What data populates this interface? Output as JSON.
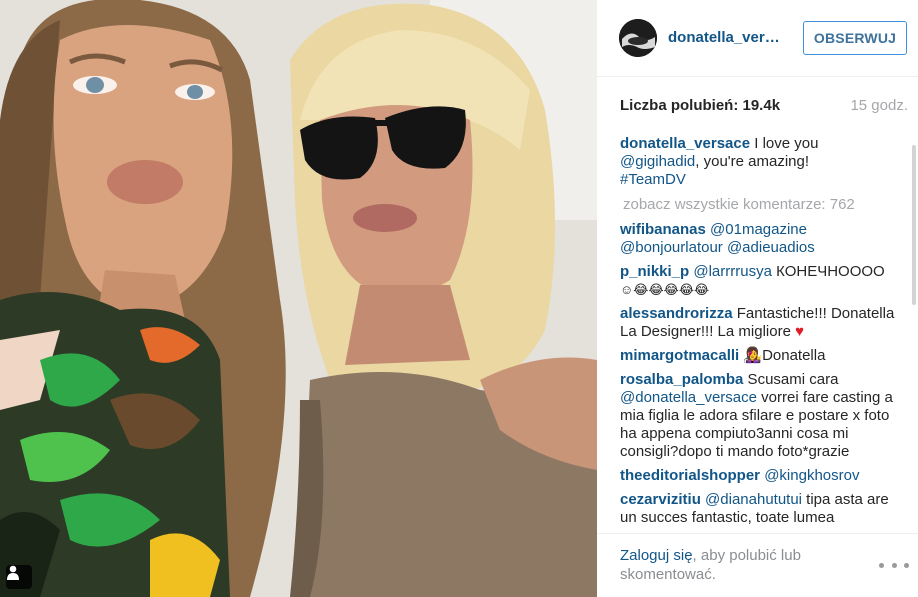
{
  "post": {
    "author": "donatella_versace",
    "follow_label": "OBSERWUJ",
    "likes_label": "Liczba polubień: 19.4k",
    "time_ago": "15 godz.",
    "caption": {
      "user": "donatella_versace",
      "text_before": " I love you ",
      "mention": "@gigihadid",
      "text_after": ", you're amazing!",
      "hashtag": "#TeamDV"
    },
    "view_all_comments": "zobacz wszystkie komentarze: 762"
  },
  "comments": [
    {
      "user": "wifibananas",
      "text": "",
      "mentions": "@01magazine @bonjourlatour @adieuadios"
    },
    {
      "user": "p_nikki_p",
      "mentions": "@larrrrusya",
      "text": " КОНЕЧНОООО",
      "emoji": "☺😂😂😂😂😂"
    },
    {
      "user": "alessandrorizza",
      "text": " Fantastiche!!! Donatella La Designer!!! La migliore ",
      "heart": "♥"
    },
    {
      "user": "mimargotmacalli",
      "text": " 👩‍🎤Donatella"
    },
    {
      "user": "rosalba_palomba",
      "text_before": " Scusami cara ",
      "mention": "@donatella_versace",
      "text": " vorrei fare casting a mia figlia le adora sfilare e postare x foto ha appena compiuto3anni cosa mi consigli?dopo ti mando foto*grazie"
    },
    {
      "user": "theeditorialshopper",
      "mention": "@kingkhosrov"
    },
    {
      "user": "cezarvizitiu",
      "mention": "@dianahututui",
      "text": " tipa asta are un succes fantastic, toate lumea"
    }
  ],
  "footer": {
    "login_link": "Zaloguj się",
    "login_rest": ", aby polubić lub skomentować."
  },
  "icons": {
    "user_tag": "person-icon",
    "more": "ellipsis-icon"
  },
  "colors": {
    "link_blue": "#125688",
    "follow_border": "#4090db",
    "muted": "#a5a7aa",
    "heart": "#e01d24"
  }
}
